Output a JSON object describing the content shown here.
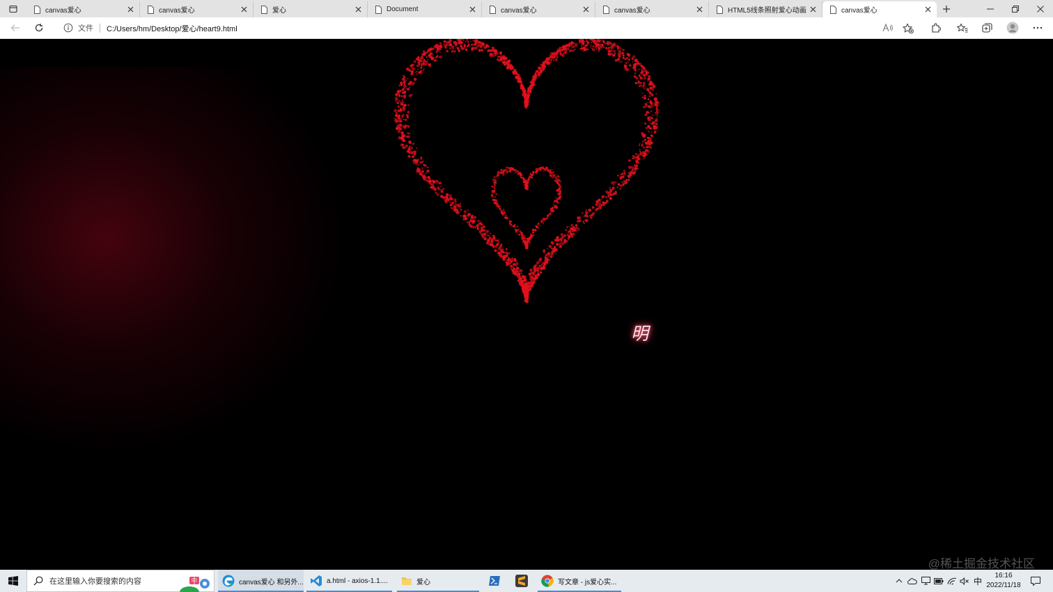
{
  "browser": {
    "tabs": [
      {
        "title": "canvas爱心"
      },
      {
        "title": "canvas爱心"
      },
      {
        "title": "爱心"
      },
      {
        "title": "Document"
      },
      {
        "title": "canvas爱心"
      },
      {
        "title": "canvas爱心"
      },
      {
        "title": "HTML5线条照射爱心动画特效"
      },
      {
        "title": "canvas爱心",
        "active": true
      }
    ],
    "address": {
      "label": "文件",
      "url": "C:/Users/hm/Desktop/爱心/heart9.html"
    }
  },
  "page": {
    "background_color": "#000000",
    "heart_color": "#e0101c",
    "glow_text": "明",
    "watermark": "@稀土掘金技术社区"
  },
  "taskbar": {
    "search_placeholder": "在这里输入你要搜索的内容",
    "apps": [
      {
        "icon": "edge-icon",
        "label": "canvas爱心 和另外..."
      },
      {
        "icon": "vscode-icon",
        "label": "a.html - axios-1.1...."
      },
      {
        "icon": "folder-icon",
        "label": "爱心"
      },
      {
        "icon": "powershell-icon",
        "label": ""
      },
      {
        "icon": "sublime-icon",
        "label": ""
      },
      {
        "icon": "chrome-icon",
        "label": "写文章 - js爱心实..."
      }
    ],
    "tray": {
      "ime": "中",
      "time": "16:16",
      "date": "2022/11/18"
    }
  }
}
